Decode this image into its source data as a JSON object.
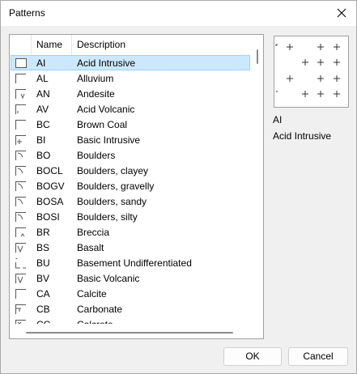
{
  "window": {
    "title": "Patterns"
  },
  "list": {
    "columns": {
      "name": "Name",
      "description": "Description"
    },
    "rows": [
      {
        "code": "AI",
        "desc": "Acid Intrusive",
        "icon": "pattern-ai-icon",
        "selected": true
      },
      {
        "code": "AL",
        "desc": "Alluvium",
        "icon": "pattern-al-icon"
      },
      {
        "code": "AN",
        "desc": "Andesite",
        "icon": "pattern-an-icon"
      },
      {
        "code": "AV",
        "desc": "Acid Volcanic",
        "icon": "pattern-av-icon"
      },
      {
        "code": "BC",
        "desc": "Brown Coal",
        "icon": "pattern-bc-icon"
      },
      {
        "code": "BI",
        "desc": "Basic Intrusive",
        "icon": "pattern-bi-icon"
      },
      {
        "code": "BO",
        "desc": "Boulders",
        "icon": "pattern-bo-icon"
      },
      {
        "code": "BOCL",
        "desc": "Boulders, clayey",
        "icon": "pattern-bocl-icon"
      },
      {
        "code": "BOGV",
        "desc": "Boulders, gravelly",
        "icon": "pattern-bogv-icon"
      },
      {
        "code": "BOSA",
        "desc": "Boulders, sandy",
        "icon": "pattern-bosa-icon"
      },
      {
        "code": "BOSI",
        "desc": "Boulders, silty",
        "icon": "pattern-bosi-icon"
      },
      {
        "code": "BR",
        "desc": "Breccia",
        "icon": "pattern-br-icon"
      },
      {
        "code": "BS",
        "desc": "Basalt",
        "icon": "pattern-bs-icon"
      },
      {
        "code": "BU",
        "desc": "Basement Undifferentiated",
        "icon": "pattern-bu-icon"
      },
      {
        "code": "BV",
        "desc": "Basic Volcanic",
        "icon": "pattern-bv-icon"
      },
      {
        "code": "CA",
        "desc": "Calcite",
        "icon": "pattern-ca-icon"
      },
      {
        "code": "CB",
        "desc": "Carbonate",
        "icon": "pattern-cb-icon"
      },
      {
        "code": "CC",
        "desc": "Calcrete",
        "icon": "pattern-cc-icon"
      }
    ]
  },
  "preview": {
    "code": "AI",
    "description": "Acid Intrusive",
    "icon": "acid-intrusive-pattern-preview"
  },
  "buttons": {
    "ok": "OK",
    "cancel": "Cancel"
  },
  "colors": {
    "selection_bg": "#cce8ff",
    "selection_border": "#99d1ff",
    "window_bg": "#f0f0f0"
  }
}
